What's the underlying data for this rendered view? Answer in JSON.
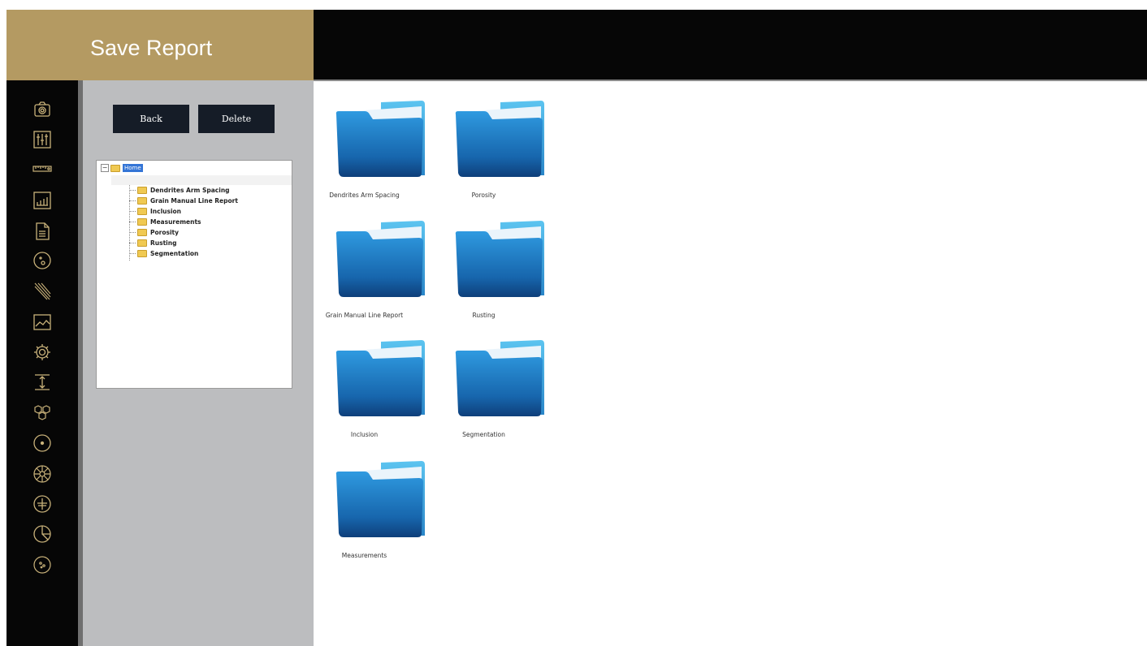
{
  "header": {
    "title": "Save Report"
  },
  "toolbar": {
    "back_label": "Back",
    "delete_label": "Delete"
  },
  "tree": {
    "root_label": "Home",
    "items": [
      "Dendrites Arm Spacing",
      "Grain Manual Line Report",
      "Inclusion",
      "Measurements",
      "Porosity",
      "Rusting",
      "Segmentation"
    ]
  },
  "sidebar": {
    "icons": [
      "camera-icon",
      "sliders-icon",
      "ruler-icon",
      "bar-chart-icon",
      "document-icon",
      "circle-dots-icon",
      "diagonal-lines-icon",
      "image-graph-icon",
      "gear-icon",
      "measure-height-icon",
      "hexagons-icon",
      "circle-dot-icon",
      "flower-icon",
      "circle-plus-icon",
      "pie-chart-icon",
      "circle-cells-icon"
    ]
  },
  "folders": [
    {
      "label": "Dendrites Arm Spacing"
    },
    {
      "label": "Porosity"
    },
    {
      "label": "Grain Manual Line Report"
    },
    {
      "label": "Rusting"
    },
    {
      "label": "Inclusion"
    },
    {
      "label": "Segmentation"
    },
    {
      "label": "Measurements"
    }
  ],
  "colors": {
    "title_bar": "#b49a62",
    "header": "#060606",
    "sidebar": "#060606",
    "sidebar_icon": "#c9b27a",
    "panel": "#bcbdbf",
    "button": "#151c27",
    "folder_front": "#1a78c2",
    "folder_back": "#4db6e8"
  }
}
